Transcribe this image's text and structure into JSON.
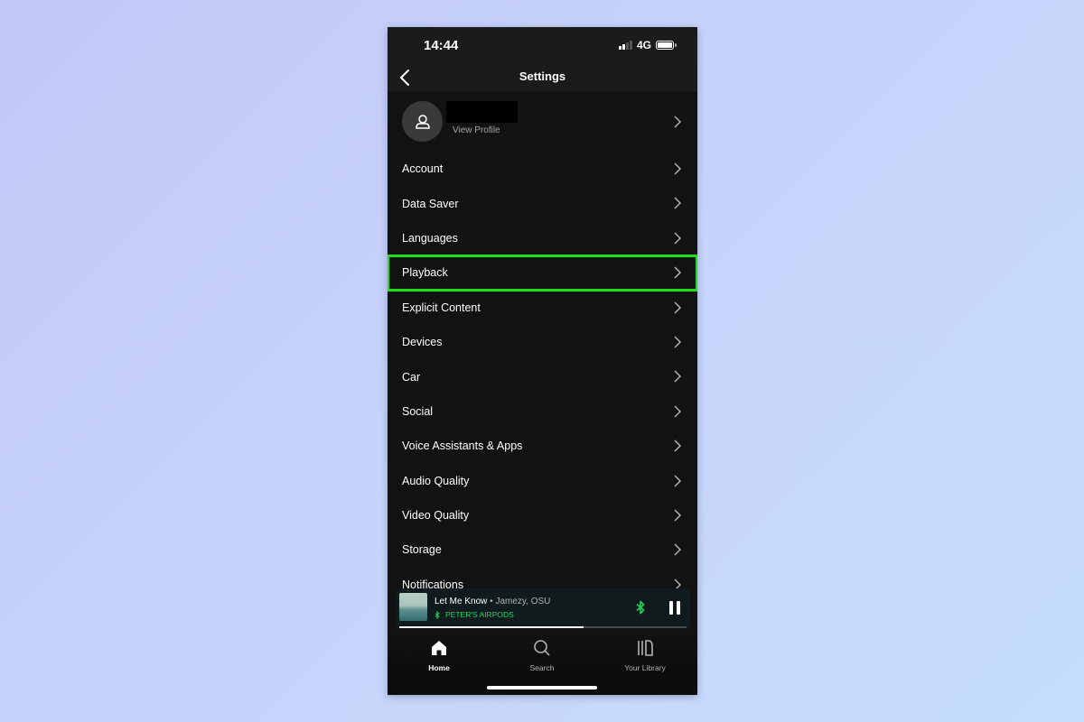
{
  "status_bar": {
    "time": "14:44",
    "network": "4G",
    "battery_level": 0.9
  },
  "header": {
    "title": "Settings",
    "back_icon": "chevron-left-icon"
  },
  "profile": {
    "name": "[redacted]",
    "view_profile_label": "View Profile",
    "avatar_icon": "user-icon"
  },
  "settings_items": [
    {
      "label": "Account"
    },
    {
      "label": "Data Saver"
    },
    {
      "label": "Languages"
    },
    {
      "label": "Playback",
      "highlighted": true
    },
    {
      "label": "Explicit Content"
    },
    {
      "label": "Devices"
    },
    {
      "label": "Car"
    },
    {
      "label": "Social"
    },
    {
      "label": "Voice Assistants & Apps"
    },
    {
      "label": "Audio Quality"
    },
    {
      "label": "Video Quality"
    },
    {
      "label": "Storage"
    },
    {
      "label": "Notifications"
    }
  ],
  "mini_player": {
    "track": "Let Me Know",
    "separator": " • ",
    "artist": "Jamezy, OSU",
    "device": "PETER'S AIRPODS",
    "progress": 0.64,
    "accent_color": "#1ed760"
  },
  "bottom_nav": [
    {
      "label": "Home",
      "icon": "home-icon",
      "active": true
    },
    {
      "label": "Search",
      "icon": "search-icon",
      "active": false
    },
    {
      "label": "Your Library",
      "icon": "library-icon",
      "active": false
    }
  ],
  "highlight_color": "#19e019"
}
